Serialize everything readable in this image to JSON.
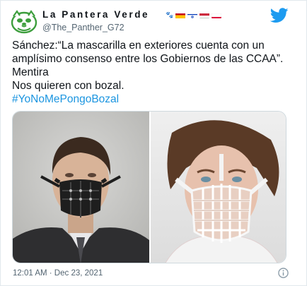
{
  "account": {
    "display_name": "La Pantera Verde",
    "handle": "@The_Panther_G72",
    "name_decorations": [
      "paw-prints-icon",
      "spain-flag",
      "israel-flag",
      "hungary-flag",
      "poland-flag"
    ]
  },
  "tweet": {
    "lines": [
      "Sánchez:“La mascarilla en exteriores cuenta con un",
      "amplísimo consenso entre los Gobiernos de las CCAA”.",
      "Mentira",
      "Nos quieren con bozal."
    ],
    "hashtag": "#YoNoMePongoBozal",
    "timestamp": "12:01 AM · Dec 23, 2021"
  },
  "colors": {
    "link": "#1b95e0",
    "twitter_blue": "#1d9bf0",
    "secondary_text": "#536471",
    "avatar_green": "#3d9e3d"
  },
  "media": {
    "images": [
      {
        "kind": "photo",
        "subject": "man-wearing-leather-muzzle"
      },
      {
        "kind": "photo",
        "subject": "woman-wearing-wire-cage-muzzle"
      }
    ]
  }
}
